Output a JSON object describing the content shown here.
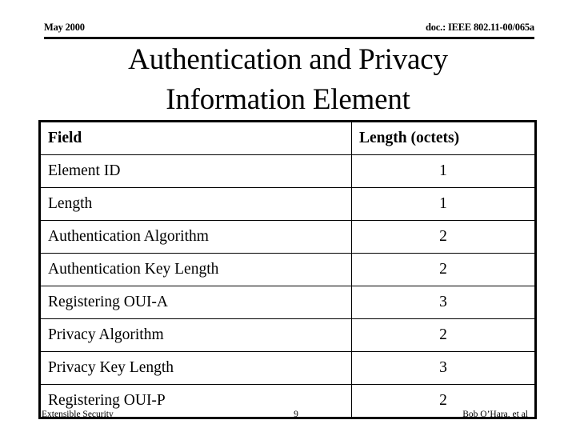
{
  "header": {
    "date": "May 2000",
    "doc_reference": "doc.: IEEE 802.11-00/065a"
  },
  "title": {
    "line1": "Authentication and Privacy",
    "line2": "Information Element"
  },
  "table": {
    "columns": [
      {
        "key": "field",
        "label": "Field",
        "align": "left"
      },
      {
        "key": "length",
        "label": "Length (octets)",
        "align": "center"
      }
    ],
    "rows": [
      {
        "field": "Element ID",
        "length": "1"
      },
      {
        "field": "Length",
        "length": "1"
      },
      {
        "field": "Authentication Algorithm",
        "length": "2"
      },
      {
        "field": "Authentication Key Length",
        "length": "2"
      },
      {
        "field": "Registering OUI-A",
        "length": "3"
      },
      {
        "field": "Privacy Algorithm",
        "length": "2"
      },
      {
        "field": "Privacy Key Length",
        "length": "3"
      },
      {
        "field": "Registering OUI-P",
        "length": "2"
      }
    ]
  },
  "footer": {
    "left": "Extensible Security",
    "page_number": "9",
    "right": "Bob O’Hara, et al"
  },
  "colors": {
    "text": "#000000",
    "background": "#ffffff",
    "rule": "#000000"
  }
}
